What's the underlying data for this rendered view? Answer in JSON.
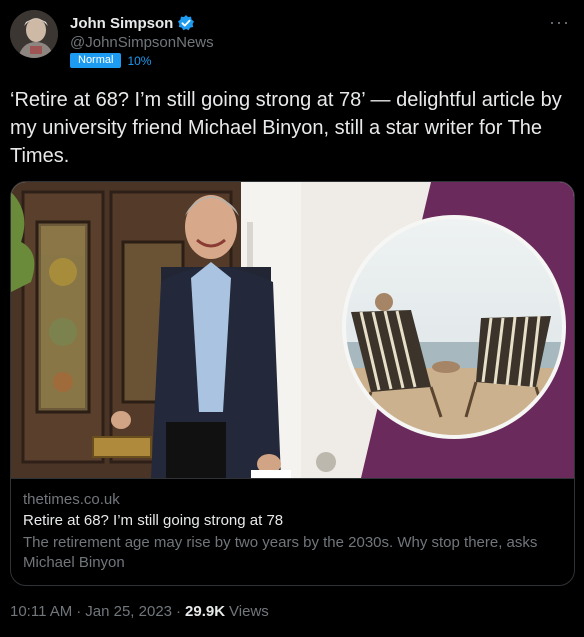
{
  "author": {
    "name": "John Simpson",
    "handle": "@JohnSimpsonNews",
    "label_badge": "Normal",
    "label_percent": "10%"
  },
  "more_icon": "more-options-icon",
  "tweet": {
    "text": "‘Retire at 68? I’m still going strong at 78’ — delightful article by my university friend Michael Binyon, still a star writer for The Times."
  },
  "card": {
    "domain": "thetimes.co.uk",
    "title": "Retire at 68? I’m still going strong at 78",
    "description": "The retirement age may rise by two years by the 2030s. Why stop there, asks Michael Binyon"
  },
  "footer": {
    "time": "10:11 AM",
    "sep1": "·",
    "date": "Jan 25, 2023",
    "sep2": "·",
    "views_count": "29.9K",
    "views_label": "Views"
  },
  "colors": {
    "verified": "#1d9bf0",
    "accent": "#1d9bf0",
    "purple_bg": "#6b2a5c"
  }
}
